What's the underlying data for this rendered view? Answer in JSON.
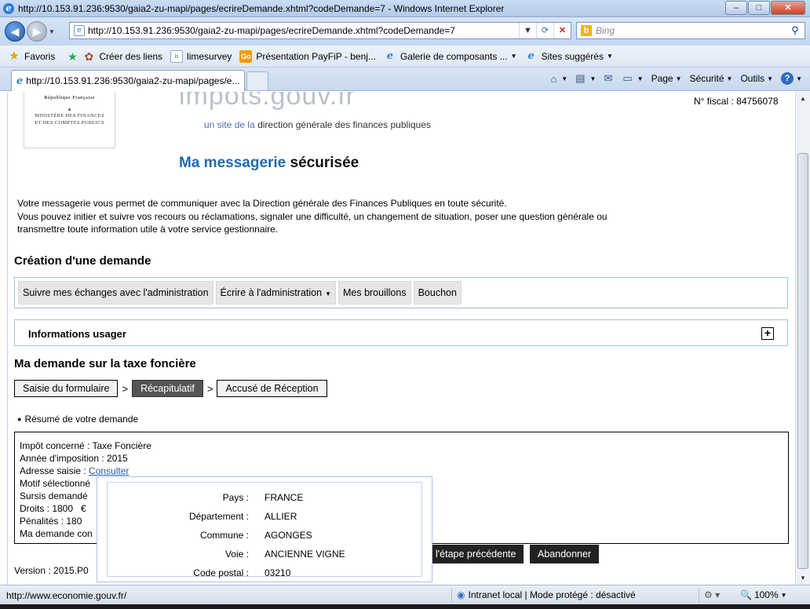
{
  "window": {
    "title": "http://10.153.91.236:9530/gaia2-zu-mapi/pages/ecrireDemande.xhtml?codeDemande=7 - Windows Internet Explorer",
    "minimize": "–",
    "maximize": "□",
    "close": "✕"
  },
  "addressbar": {
    "url": "http://10.153.91.236:9530/gaia2-zu-mapi/pages/ecrireDemande.xhtml?codeDemande=7",
    "search_placeholder": "Bing"
  },
  "favorites": {
    "label": "Favoris",
    "items": [
      {
        "label": "Créer des liens",
        "icon": "gear-icon"
      },
      {
        "label": "limesurvey",
        "icon": "limesurvey-icon"
      },
      {
        "label": "Présentation PayFiP - benj...",
        "icon": "go-icon"
      },
      {
        "label": "Galerie de composants ...",
        "icon": "ie-page-icon"
      },
      {
        "label": "Sites suggérés",
        "icon": "ie-page-icon"
      }
    ]
  },
  "tab": {
    "label": "http://10.153.91.236:9530/gaia2-zu-mapi/pages/e..."
  },
  "commandbar": {
    "page": "Page",
    "securite": "Sécurité",
    "outils": "Outils"
  },
  "header": {
    "republique": "République Française",
    "ministere_line1": "MINISTÈRE DES FINANCES",
    "ministere_line2": "ET DES COMPTES PUBLICS",
    "brand": "impots.gouv.fr",
    "tagline_prefix": "un site de la",
    "tagline_rest": "direction générale des finances publiques",
    "fiscal": "N° fiscal : 84756078"
  },
  "page": {
    "title_part1": "Ma messagerie",
    "title_part2": "sécurisée",
    "intro_line1": "Votre messagerie vous permet de communiquer avec la Direction générale des Finances Publiques en toute sécurité.",
    "intro_line2": "Vous pouvez initier et suivre vos recours ou réclamations, signaler une difficulté, un changement de situation, poser une question générale ou",
    "intro_line3": "transmettre toute information utile à votre service gestionnaire.",
    "creation_title": "Création d'une demande"
  },
  "nav": {
    "items": [
      {
        "label": "Suivre mes échanges avec l'administration"
      },
      {
        "label": "Écrire à l'administration",
        "dropdown": true
      },
      {
        "label": "Mes brouillons"
      },
      {
        "label": "Bouchon"
      }
    ]
  },
  "info_usager": {
    "label": "Informations usager",
    "toggle": "+"
  },
  "demande": {
    "title": "Ma demande sur la taxe foncière",
    "steps": [
      {
        "label": "Saisie du formulaire",
        "active": false
      },
      {
        "label": "Récapitulatif",
        "active": true
      },
      {
        "label": "Accusé de Réception",
        "active": false
      }
    ],
    "step_separator": ">",
    "resume_label": "Résumé de votre demande"
  },
  "summary": {
    "impot": "Impôt concerné : Taxe Foncière",
    "annee": "Année d'imposition : 2015",
    "adresse_label": "Adresse saisie : ",
    "adresse_link": "Consulter",
    "motif": "Motif sélectionné",
    "sursis": "Sursis demandé",
    "droits": "Droits : 1800   €",
    "penalites": "Pénalités : 180",
    "ma_demande": "Ma demande con"
  },
  "buttons": {
    "previous": "l'étape précédente",
    "abandon": "Abandonner"
  },
  "version": "Version : 2015.P0",
  "address_popup": {
    "rows": [
      {
        "key": "Pays :",
        "value": "FRANCE"
      },
      {
        "key": "Département :",
        "value": "ALLIER"
      },
      {
        "key": "Commune :",
        "value": "AGONGES"
      },
      {
        "key": "Voie :",
        "value": "ANCIENNE VIGNE"
      },
      {
        "key": "Code postal :",
        "value": "03210"
      }
    ]
  },
  "statusbar": {
    "url": "http://www.economie.gouv.fr/",
    "zone": "Intranet local | Mode protégé : désactivé",
    "zoom": "100%"
  }
}
